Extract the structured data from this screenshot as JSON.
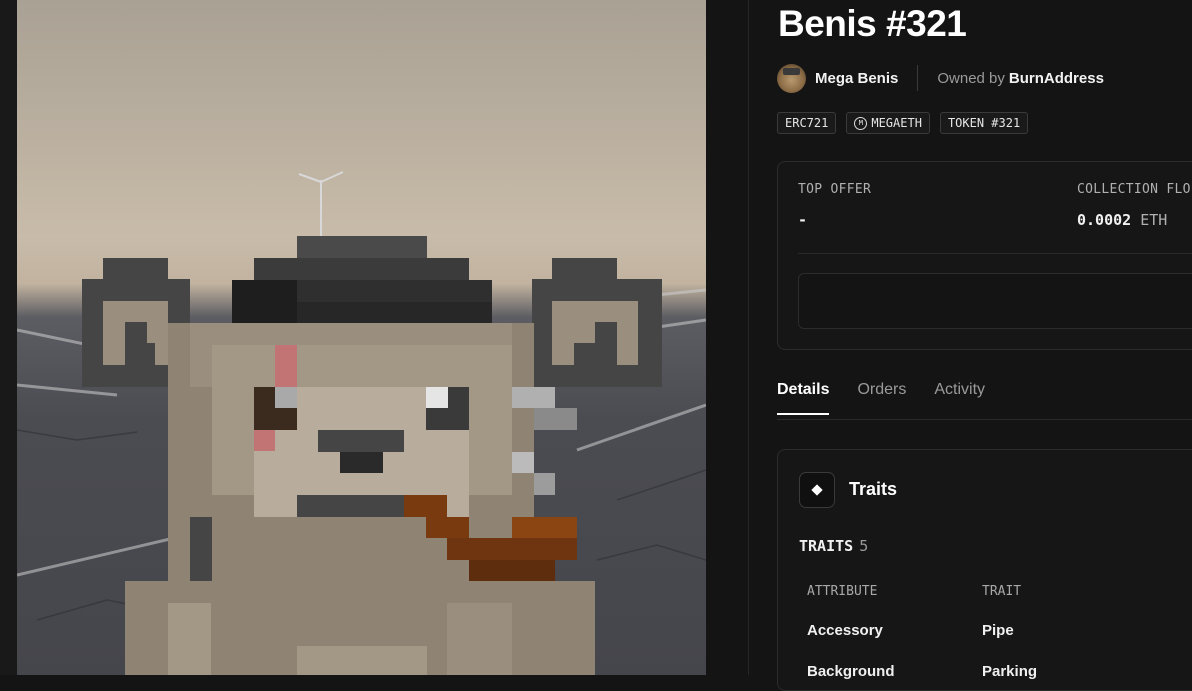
{
  "nft": {
    "title": "Benis #321",
    "image_alt": "Pixel-art bear wearing a hat and smoking a pipe in a parking lot"
  },
  "creator": {
    "collection_name": "Mega Benis",
    "owned_by_label": "Owned by",
    "owner_name": "BurnAddress"
  },
  "badges": [
    {
      "label": "ERC721",
      "icon": ""
    },
    {
      "label": "MEGAETH",
      "icon": "megaeth-logo-icon"
    },
    {
      "label": "TOKEN #321",
      "icon": ""
    }
  ],
  "offer_card": {
    "top_offer_label": "TOP OFFER",
    "top_offer_value": "-",
    "floor_label": "COLLECTION FLO",
    "floor_value": "0.0002",
    "floor_unit": "ETH"
  },
  "tabs": [
    {
      "label": "Details",
      "active": true
    },
    {
      "label": "Orders",
      "active": false
    },
    {
      "label": "Activity",
      "active": false
    }
  ],
  "traits": {
    "heading": "Traits",
    "count_label": "TRAITS",
    "count": "5",
    "columns": {
      "attribute": "ATTRIBUTE",
      "trait": "TRAIT"
    },
    "rows": [
      {
        "attribute": "Accessory",
        "trait": "Pipe"
      },
      {
        "attribute": "Background",
        "trait": "Parking"
      }
    ]
  },
  "colors": {
    "page_bg": "#141414",
    "card_bg": "#161616",
    "border": "#2c2c2c",
    "muted_text": "#9a9a9a",
    "pipe_brown": "#8b4513"
  }
}
